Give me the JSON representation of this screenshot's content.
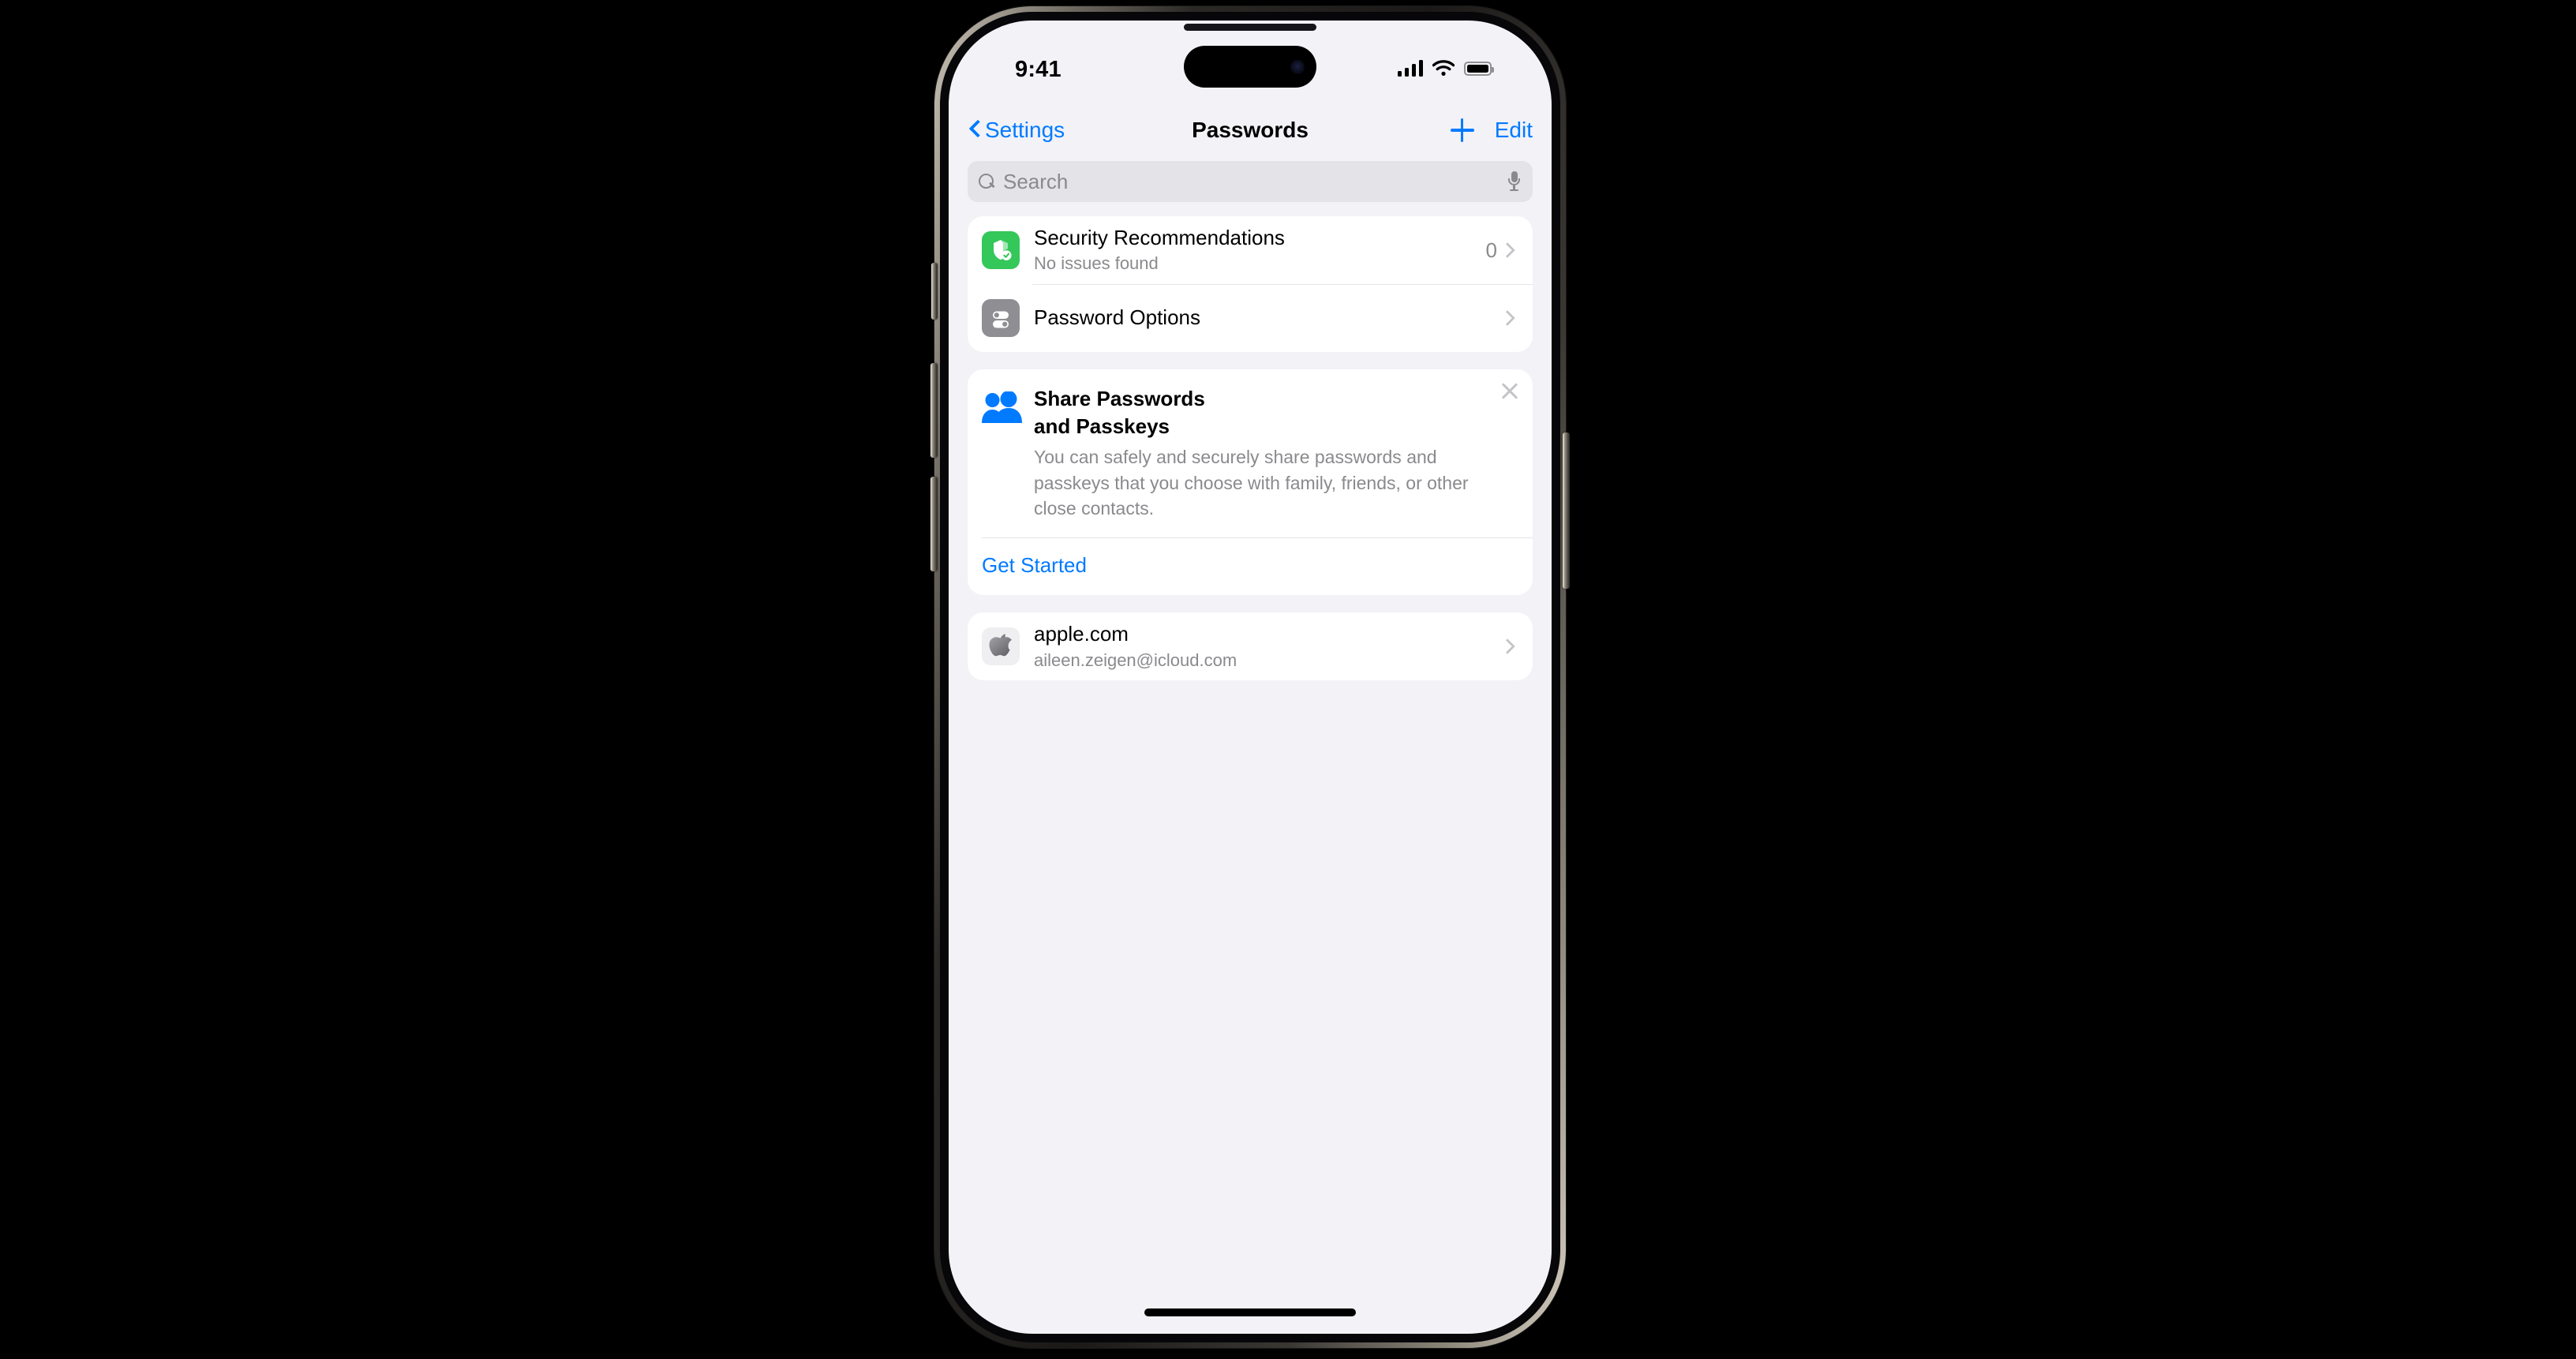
{
  "status_bar": {
    "time": "9:41",
    "signal_icon": "cellular-signal-icon",
    "wifi_icon": "wifi-icon",
    "battery_icon": "battery-full-icon"
  },
  "nav_bar": {
    "back_label": "Settings",
    "title": "Passwords",
    "add_label": "+",
    "edit_label": "Edit"
  },
  "search": {
    "placeholder": "Search",
    "mic_icon": "microphone-icon",
    "search_icon": "search-icon"
  },
  "sections": {
    "settings_rows": [
      {
        "title": "Security Recommendations",
        "subtitle": "No issues found",
        "value": "0",
        "icon": "shield-check-icon",
        "icon_color": "#34C759"
      },
      {
        "title": "Password Options",
        "subtitle": "",
        "value": "",
        "icon": "toggles-icon",
        "icon_color": "#8E8E93"
      }
    ],
    "share_card": {
      "icon": "two-people-icon",
      "title_line1": "Share Passwords",
      "title_line2": "and Passkeys",
      "description": "You can safely and securely share passwords and passkeys that you choose with family, friends, or other close contacts.",
      "action_label": "Get Started",
      "close_icon": "close-icon"
    },
    "accounts": [
      {
        "title": "apple.com",
        "subtitle": "aileen.zeigen@icloud.com",
        "icon": "apple-logo-icon"
      }
    ]
  },
  "colors": {
    "accent_blue": "#007AFF",
    "green": "#34C759",
    "gray": "#8E8E93",
    "background": "#F2F2F7",
    "card": "#FFFFFF",
    "secondary_text": "#8A8A8E"
  }
}
